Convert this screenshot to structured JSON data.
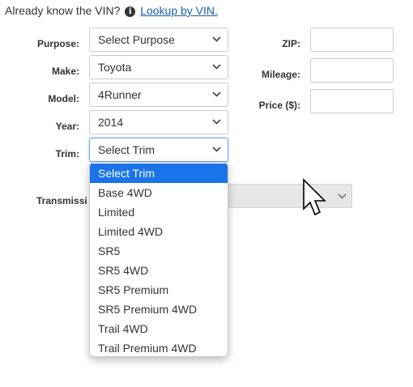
{
  "vin_prompt": {
    "text": "Already know the VIN?",
    "icon": "info-circle",
    "link": "Lookup by VIN."
  },
  "form": {
    "purpose": {
      "label": "Purpose:",
      "value": "Select Purpose"
    },
    "make": {
      "label": "Make:",
      "value": "Toyota"
    },
    "model": {
      "label": "Model:",
      "value": "4Runner"
    },
    "year": {
      "label": "Year:",
      "value": "2014"
    },
    "trim": {
      "label": "Trim:",
      "value": "Select Trim"
    },
    "transmission": {
      "label": "Transmissi",
      "value": ""
    },
    "zip": {
      "label": "ZIP:",
      "value": ""
    },
    "mileage": {
      "label": "Mileage:",
      "value": ""
    },
    "price": {
      "label": "Price ($):",
      "value": ""
    }
  },
  "trim_dropdown": {
    "options": [
      "Select Trim",
      "Base 4WD",
      "Limited",
      "Limited 4WD",
      "SR5",
      "SR5 4WD",
      "SR5 Premium",
      "SR5 Premium 4WD",
      "Trail 4WD",
      "Trail Premium 4WD"
    ],
    "highlighted": "Select Trim",
    "highlight_color": "#1a73e8"
  },
  "colors": {
    "link": "#1a5ea8",
    "text": "#333333",
    "disabled_bg": "#e6e6e6"
  }
}
